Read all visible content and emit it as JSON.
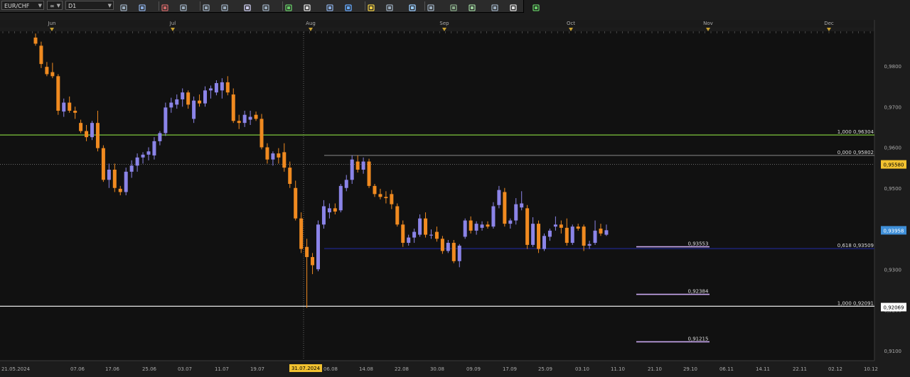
{
  "toolbar": {
    "symbol": "EUR/CHF",
    "timeframe": "D1",
    "icons": [
      "chart-type-icon",
      "link-icon",
      "bars-icon",
      "candles-icon",
      "zoom-in-icon",
      "zoom-out-icon",
      "cursor-icon",
      "crosshair-icon",
      "add-line-icon",
      "text-icon",
      "eye-icon",
      "globe-icon",
      "pen-icon",
      "indicator-icon",
      "template-icon",
      "fib-icon",
      "channel-icon",
      "trend-icon",
      "ellipse-icon",
      "eraser-icon",
      "grid-icon"
    ]
  },
  "x_axis_top": [
    "Jun",
    "Jul",
    "Aug",
    "Sep",
    "Oct",
    "Nov",
    "Dec"
  ],
  "x_axis_bottom": [
    "21.05.2024",
    "07.06",
    "17.06",
    "25.06",
    "03.07",
    "11.07",
    "19.07",
    "31.07.2024",
    "06.08",
    "14.08",
    "22.08",
    "30.08",
    "09.09",
    "17.09",
    "25.09",
    "03.10",
    "11.10",
    "21.10",
    "29.10",
    "06.11",
    "14.11",
    "22.11",
    "02.12",
    "10.12"
  ],
  "crosshair_date": "31.07.2024",
  "y_axis": [
    "0,9800",
    "0,9700",
    "0,9600",
    "0,9500",
    "0,9400",
    "0,9300",
    "0,9200",
    "0,9100"
  ],
  "price_tags": {
    "crosshair": "0,95580",
    "last": "0,93958",
    "level_low": "0,92069"
  },
  "level_labels": {
    "green_line": "1,000 0,96304",
    "gray_line": "0,000 0,95802",
    "navy_line": "0,618 0,93509",
    "white_line": "1,000 0,92091",
    "target1": "0,93553",
    "target2": "0,92384",
    "target3": "0,91215"
  },
  "colors": {
    "bull": "#8b84e8",
    "bear": "#f08a20",
    "green_line": "#7ec83a",
    "gray_line": "#8a8a8a",
    "navy_line": "#1a1f60",
    "white_line": "#ffffff",
    "target": "#c9a8f0",
    "last_tag": "#3f8fd8",
    "crosshair_tag": "#f2c230"
  },
  "chart_data": {
    "type": "candlestick",
    "title": "",
    "symbol": "EUR/CHF",
    "timeframe": "D1",
    "ylim": [
      0.908,
      0.988
    ],
    "levels": [
      {
        "label": "1,000 0,96304",
        "value": 0.96304
      },
      {
        "label": "0,000 0,95802",
        "value": 0.95802
      },
      {
        "label": "0,618 0,93509",
        "value": 0.93509
      },
      {
        "label": "1,000 0,92091",
        "value": 0.92091
      }
    ],
    "targets": [
      0.93553,
      0.92384,
      0.91215
    ],
    "candles": [
      {
        "o": 0.987,
        "h": 0.988,
        "l": 0.985,
        "c": 0.9855
      },
      {
        "o": 0.985,
        "h": 0.986,
        "l": 0.9795,
        "c": 0.9805
      },
      {
        "o": 0.9798,
        "h": 0.981,
        "l": 0.9775,
        "c": 0.978
      },
      {
        "o": 0.9785,
        "h": 0.9808,
        "l": 0.977,
        "c": 0.9775
      },
      {
        "o": 0.9775,
        "h": 0.978,
        "l": 0.968,
        "c": 0.969
      },
      {
        "o": 0.9688,
        "h": 0.972,
        "l": 0.9675,
        "c": 0.971
      },
      {
        "o": 0.971,
        "h": 0.9725,
        "l": 0.9685,
        "c": 0.969
      },
      {
        "o": 0.969,
        "h": 0.97,
        "l": 0.967,
        "c": 0.9685
      },
      {
        "o": 0.966,
        "h": 0.9668,
        "l": 0.9635,
        "c": 0.964
      },
      {
        "o": 0.964,
        "h": 0.9655,
        "l": 0.9615,
        "c": 0.9625
      },
      {
        "o": 0.9625,
        "h": 0.9665,
        "l": 0.9618,
        "c": 0.966
      },
      {
        "o": 0.966,
        "h": 0.969,
        "l": 0.959,
        "c": 0.9598
      },
      {
        "o": 0.9598,
        "h": 0.9605,
        "l": 0.9515,
        "c": 0.952
      },
      {
        "o": 0.952,
        "h": 0.956,
        "l": 0.95,
        "c": 0.9545
      },
      {
        "o": 0.9545,
        "h": 0.956,
        "l": 0.949,
        "c": 0.95
      },
      {
        "o": 0.9498,
        "h": 0.9505,
        "l": 0.9482,
        "c": 0.949
      },
      {
        "o": 0.949,
        "h": 0.955,
        "l": 0.9482,
        "c": 0.954
      },
      {
        "o": 0.954,
        "h": 0.9568,
        "l": 0.9525,
        "c": 0.9555
      },
      {
        "o": 0.9555,
        "h": 0.9585,
        "l": 0.954,
        "c": 0.9575
      },
      {
        "o": 0.9575,
        "h": 0.9588,
        "l": 0.956,
        "c": 0.9582
      },
      {
        "o": 0.9582,
        "h": 0.96,
        "l": 0.9568,
        "c": 0.959
      },
      {
        "o": 0.958,
        "h": 0.9625,
        "l": 0.957,
        "c": 0.9615
      },
      {
        "o": 0.9615,
        "h": 0.964,
        "l": 0.9605,
        "c": 0.9635
      },
      {
        "o": 0.9635,
        "h": 0.971,
        "l": 0.9628,
        "c": 0.9698
      },
      {
        "o": 0.9698,
        "h": 0.9722,
        "l": 0.9685,
        "c": 0.971
      },
      {
        "o": 0.9705,
        "h": 0.973,
        "l": 0.9695,
        "c": 0.9718
      },
      {
        "o": 0.9718,
        "h": 0.9745,
        "l": 0.97,
        "c": 0.9735
      },
      {
        "o": 0.9735,
        "h": 0.974,
        "l": 0.9695,
        "c": 0.9705
      },
      {
        "o": 0.967,
        "h": 0.9725,
        "l": 0.966,
        "c": 0.9715
      },
      {
        "o": 0.9715,
        "h": 0.973,
        "l": 0.97,
        "c": 0.9708
      },
      {
        "o": 0.9708,
        "h": 0.975,
        "l": 0.97,
        "c": 0.974
      },
      {
        "o": 0.974,
        "h": 0.9752,
        "l": 0.972,
        "c": 0.9745
      },
      {
        "o": 0.9735,
        "h": 0.9765,
        "l": 0.9728,
        "c": 0.9758
      },
      {
        "o": 0.974,
        "h": 0.977,
        "l": 0.972,
        "c": 0.976
      },
      {
        "o": 0.976,
        "h": 0.9775,
        "l": 0.9728,
        "c": 0.9735
      },
      {
        "o": 0.973,
        "h": 0.9745,
        "l": 0.966,
        "c": 0.9665
      },
      {
        "o": 0.9665,
        "h": 0.968,
        "l": 0.9645,
        "c": 0.966
      },
      {
        "o": 0.966,
        "h": 0.969,
        "l": 0.965,
        "c": 0.968
      },
      {
        "o": 0.9668,
        "h": 0.969,
        "l": 0.9655,
        "c": 0.9675
      },
      {
        "o": 0.968,
        "h": 0.9688,
        "l": 0.9665,
        "c": 0.967
      },
      {
        "o": 0.967,
        "h": 0.9682,
        "l": 0.9595,
        "c": 0.96
      },
      {
        "o": 0.96,
        "h": 0.961,
        "l": 0.956,
        "c": 0.957
      },
      {
        "o": 0.957,
        "h": 0.959,
        "l": 0.9555,
        "c": 0.9585
      },
      {
        "o": 0.9585,
        "h": 0.9598,
        "l": 0.956,
        "c": 0.9575
      },
      {
        "o": 0.9588,
        "h": 0.961,
        "l": 0.954,
        "c": 0.955
      },
      {
        "o": 0.955,
        "h": 0.9565,
        "l": 0.95,
        "c": 0.951
      },
      {
        "o": 0.95,
        "h": 0.9518,
        "l": 0.942,
        "c": 0.9425
      },
      {
        "o": 0.9425,
        "h": 0.944,
        "l": 0.934,
        "c": 0.935
      },
      {
        "o": 0.9355,
        "h": 0.9375,
        "l": 0.9205,
        "c": 0.933
      },
      {
        "o": 0.933,
        "h": 0.934,
        "l": 0.9288,
        "c": 0.931
      },
      {
        "o": 0.93,
        "h": 0.942,
        "l": 0.9295,
        "c": 0.941
      },
      {
        "o": 0.941,
        "h": 0.947,
        "l": 0.94,
        "c": 0.9455
      },
      {
        "o": 0.944,
        "h": 0.9462,
        "l": 0.9425,
        "c": 0.945
      },
      {
        "o": 0.945,
        "h": 0.9462,
        "l": 0.9435,
        "c": 0.9442
      },
      {
        "o": 0.9445,
        "h": 0.951,
        "l": 0.944,
        "c": 0.9505
      },
      {
        "o": 0.95,
        "h": 0.9532,
        "l": 0.9492,
        "c": 0.952
      },
      {
        "o": 0.952,
        "h": 0.958,
        "l": 0.951,
        "c": 0.957
      },
      {
        "o": 0.9565,
        "h": 0.958,
        "l": 0.9538,
        "c": 0.9545
      },
      {
        "o": 0.9545,
        "h": 0.9575,
        "l": 0.9535,
        "c": 0.9565
      },
      {
        "o": 0.9565,
        "h": 0.9572,
        "l": 0.95,
        "c": 0.9505
      },
      {
        "o": 0.9505,
        "h": 0.951,
        "l": 0.9478,
        "c": 0.9485
      },
      {
        "o": 0.9485,
        "h": 0.9498,
        "l": 0.9472,
        "c": 0.9478
      },
      {
        "o": 0.9478,
        "h": 0.9492,
        "l": 0.9462,
        "c": 0.9475
      },
      {
        "o": 0.9485,
        "h": 0.9495,
        "l": 0.9448,
        "c": 0.946
      },
      {
        "o": 0.9455,
        "h": 0.9462,
        "l": 0.9405,
        "c": 0.941
      },
      {
        "o": 0.941,
        "h": 0.942,
        "l": 0.9355,
        "c": 0.9365
      },
      {
        "o": 0.9365,
        "h": 0.9385,
        "l": 0.9358,
        "c": 0.9378
      },
      {
        "o": 0.9378,
        "h": 0.94,
        "l": 0.9365,
        "c": 0.9392
      },
      {
        "o": 0.9385,
        "h": 0.9435,
        "l": 0.938,
        "c": 0.9425
      },
      {
        "o": 0.9425,
        "h": 0.944,
        "l": 0.9378,
        "c": 0.9385
      },
      {
        "o": 0.9385,
        "h": 0.9398,
        "l": 0.9375,
        "c": 0.9385
      },
      {
        "o": 0.9392,
        "h": 0.9405,
        "l": 0.9368,
        "c": 0.9375
      },
      {
        "o": 0.9375,
        "h": 0.9382,
        "l": 0.9338,
        "c": 0.9345
      },
      {
        "o": 0.9345,
        "h": 0.9372,
        "l": 0.934,
        "c": 0.9365
      },
      {
        "o": 0.9365,
        "h": 0.9372,
        "l": 0.9315,
        "c": 0.932
      },
      {
        "o": 0.932,
        "h": 0.9362,
        "l": 0.9305,
        "c": 0.9358
      },
      {
        "o": 0.938,
        "h": 0.9425,
        "l": 0.9375,
        "c": 0.942
      },
      {
        "o": 0.942,
        "h": 0.943,
        "l": 0.9388,
        "c": 0.9395
      },
      {
        "o": 0.9395,
        "h": 0.9418,
        "l": 0.9385,
        "c": 0.9412
      },
      {
        "o": 0.9402,
        "h": 0.9418,
        "l": 0.9395,
        "c": 0.941
      },
      {
        "o": 0.941,
        "h": 0.9418,
        "l": 0.94,
        "c": 0.9405
      },
      {
        "o": 0.9405,
        "h": 0.9465,
        "l": 0.94,
        "c": 0.9455
      },
      {
        "o": 0.9458,
        "h": 0.9505,
        "l": 0.945,
        "c": 0.9495
      },
      {
        "o": 0.949,
        "h": 0.95,
        "l": 0.9405,
        "c": 0.9412
      },
      {
        "o": 0.9412,
        "h": 0.9425,
        "l": 0.94,
        "c": 0.942
      },
      {
        "o": 0.942,
        "h": 0.9475,
        "l": 0.941,
        "c": 0.946
      },
      {
        "o": 0.9452,
        "h": 0.9492,
        "l": 0.9445,
        "c": 0.9462
      },
      {
        "o": 0.945,
        "h": 0.9458,
        "l": 0.935,
        "c": 0.936
      },
      {
        "o": 0.936,
        "h": 0.9428,
        "l": 0.9355,
        "c": 0.9412
      },
      {
        "o": 0.9412,
        "h": 0.942,
        "l": 0.934,
        "c": 0.935
      },
      {
        "o": 0.935,
        "h": 0.9388,
        "l": 0.9345,
        "c": 0.9382
      },
      {
        "o": 0.938,
        "h": 0.94,
        "l": 0.937,
        "c": 0.9395
      },
      {
        "o": 0.9405,
        "h": 0.943,
        "l": 0.9395,
        "c": 0.941
      },
      {
        "o": 0.941,
        "h": 0.942,
        "l": 0.9388,
        "c": 0.9402
      },
      {
        "o": 0.9402,
        "h": 0.9425,
        "l": 0.9358,
        "c": 0.9365
      },
      {
        "o": 0.9365,
        "h": 0.941,
        "l": 0.936,
        "c": 0.9405
      },
      {
        "o": 0.9405,
        "h": 0.9412,
        "l": 0.9395,
        "c": 0.94
      },
      {
        "o": 0.9405,
        "h": 0.941,
        "l": 0.9345,
        "c": 0.9358
      },
      {
        "o": 0.9358,
        "h": 0.937,
        "l": 0.935,
        "c": 0.9362
      },
      {
        "o": 0.9365,
        "h": 0.942,
        "l": 0.936,
        "c": 0.9395
      },
      {
        "o": 0.94,
        "h": 0.9412,
        "l": 0.9382,
        "c": 0.9388
      },
      {
        "o": 0.9385,
        "h": 0.941,
        "l": 0.9382,
        "c": 0.9396
      }
    ]
  }
}
